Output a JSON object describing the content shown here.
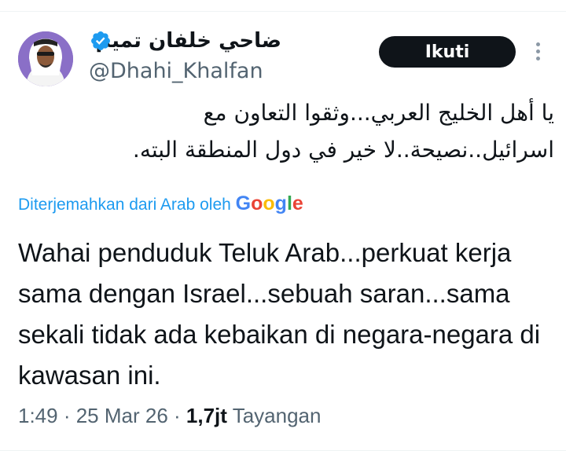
{
  "author": {
    "display_name": "ضاحي خلفان تميم",
    "handle": "@Dhahi_Khalfan",
    "verified": true
  },
  "actions": {
    "follow_label": "Ikuti",
    "more_icon": "more-vertical-icon"
  },
  "tweet": {
    "original_text": "يا أهل الخليج العربي...وثقوا التعاون مع اسرائيل..نصيحة..لا خير في دول المنطقة البته.",
    "translated_by_prefix": "Diterjemahkan dari Arab oleh ",
    "translated_by_brand": "Google",
    "translated_text": "Wahai penduduk Teluk Arab...perkuat kerja sama dengan Israel...sebuah saran...sama sekali tidak ada kebaikan di negara-negara di kawasan ini."
  },
  "meta": {
    "time": "1:49",
    "sep1": " · ",
    "date": "25 Mar 26",
    "sep2": " · ",
    "views_count": "1,7jt",
    "views_label": " Tayangan"
  },
  "colors": {
    "accent": "#1d9bf0",
    "text_primary": "#0f1419",
    "text_secondary": "#536471",
    "button_bg": "#0f1419",
    "google_blue": "#4285f4",
    "google_red": "#ea4335",
    "google_yellow": "#fbbc05",
    "google_green": "#34a853"
  }
}
